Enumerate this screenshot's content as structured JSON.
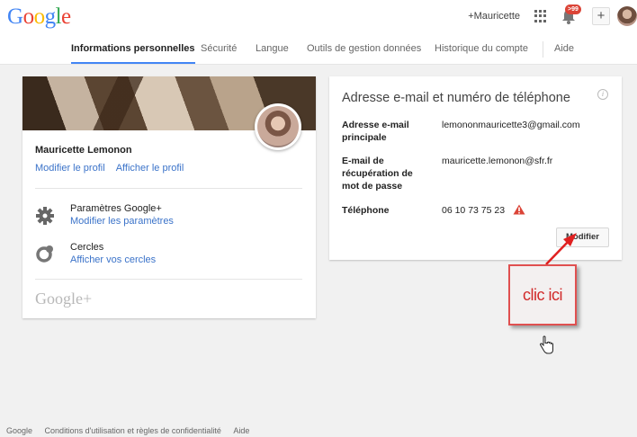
{
  "header": {
    "logo_letters": [
      {
        "char": "G",
        "color": "#4285f4"
      },
      {
        "char": "o",
        "color": "#ea4335"
      },
      {
        "char": "o",
        "color": "#fbbc05"
      },
      {
        "char": "g",
        "color": "#4285f4"
      },
      {
        "char": "l",
        "color": "#34a853"
      },
      {
        "char": "e",
        "color": "#ea4335"
      }
    ],
    "user_link": "+Mauricette",
    "notification_count": ">99",
    "add_label": "+",
    "apps_icon": "apps-grid-icon",
    "bell_icon": "bell-icon"
  },
  "tabs": [
    {
      "label": "Informations personnelles",
      "active": true
    },
    {
      "label": "Sécurité",
      "active": false
    },
    {
      "label": "Langue",
      "active": false
    },
    {
      "label": "Outils de gestion données",
      "active": false
    },
    {
      "label": "Historique du compte",
      "active": false
    },
    {
      "label": "Aide",
      "active": false
    }
  ],
  "profile": {
    "name": "Mauricette Lemonon",
    "edit_profile": "Modifier le profil",
    "view_profile": "Afficher le profil",
    "settings_title": "Paramètres Google+",
    "settings_link": "Modifier les paramètres",
    "circles_title": "Cercles",
    "circles_link": "Afficher vos cercles",
    "gplus_logo": "Google+"
  },
  "contact": {
    "title": "Adresse e-mail et numéro de téléphone",
    "info_icon": "i",
    "fields": [
      {
        "label": "Adresse e-mail principale",
        "value": "lemononmauricette3@gmail.com"
      },
      {
        "label": "E-mail de récupération de mot de passe",
        "value": "mauricette.lemonon@sfr.fr"
      },
      {
        "label": "Téléphone",
        "value": "06 10 73 75 23"
      }
    ],
    "modify_button": "Modifier",
    "warning_color": "#db4437"
  },
  "annotation": {
    "text": "clic ici",
    "color": "#d12a2a"
  },
  "footer": {
    "links": [
      "Google",
      "Conditions d'utilisation et règles de confidentialité",
      "Aide"
    ]
  }
}
